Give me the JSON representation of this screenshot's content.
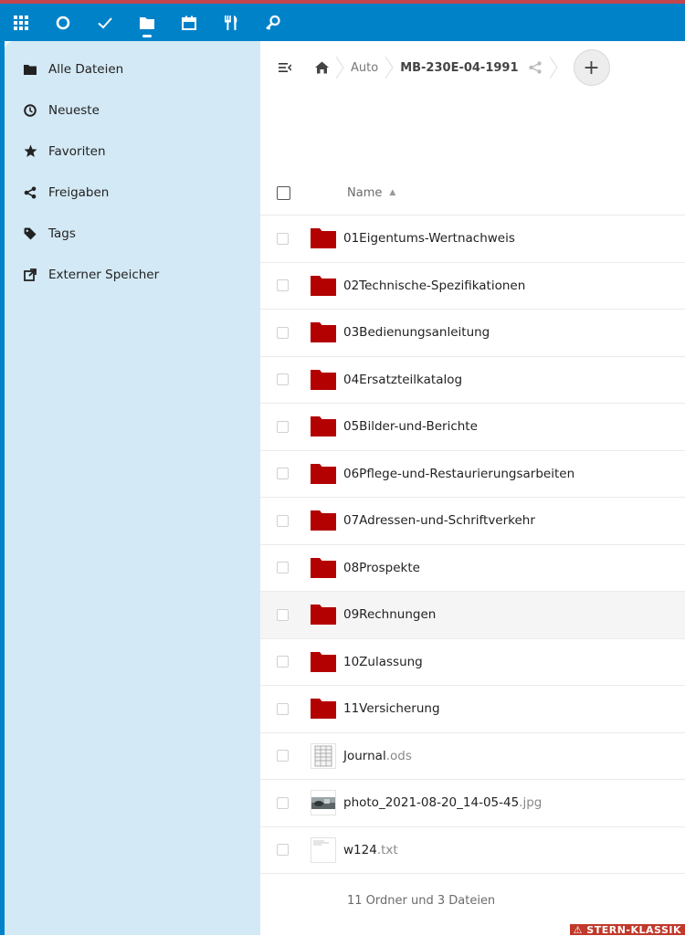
{
  "header": {
    "apps": [
      {
        "name": "app-menu-icon",
        "label": "Apps"
      },
      {
        "name": "dashboard-icon",
        "label": "Dashboard"
      },
      {
        "name": "tasks-icon",
        "label": "Tasks"
      },
      {
        "name": "files-icon",
        "label": "Files",
        "active": true
      },
      {
        "name": "calendar-icon",
        "label": "Calendar"
      },
      {
        "name": "cookbook-icon",
        "label": "Cookbook"
      },
      {
        "name": "passwords-icon",
        "label": "Passwords"
      }
    ],
    "color": "#0082c9"
  },
  "sidebar": {
    "items": [
      {
        "label": "Alle Dateien",
        "icon": "folder-icon"
      },
      {
        "label": "Neueste",
        "icon": "clock-icon"
      },
      {
        "label": "Favoriten",
        "icon": "star-icon"
      },
      {
        "label": "Freigaben",
        "icon": "share-icon"
      },
      {
        "label": "Tags",
        "icon": "tag-icon"
      },
      {
        "label": "Externer Speicher",
        "icon": "external-storage-icon"
      }
    ],
    "color": "#d3e9f5"
  },
  "breadcrumb": {
    "parent": "Auto",
    "current": "MB-230E-04-1991",
    "add_label": "+"
  },
  "table": {
    "header_name": "Name",
    "sort_arrow": "▲",
    "rows": [
      {
        "name": "01Eigentums-Wertnachweis",
        "ext": "",
        "type": "folder"
      },
      {
        "name": "02Technische-Spezifikationen",
        "ext": "",
        "type": "folder"
      },
      {
        "name": "03Bedienungsanleitung",
        "ext": "",
        "type": "folder"
      },
      {
        "name": "04Ersatzteilkatalog",
        "ext": "",
        "type": "folder"
      },
      {
        "name": "05Bilder-und-Berichte",
        "ext": "",
        "type": "folder"
      },
      {
        "name": "06Pflege-und-Restaurierungsarbeiten",
        "ext": "",
        "type": "folder"
      },
      {
        "name": "07Adressen-und-Schriftverkehr",
        "ext": "",
        "type": "folder"
      },
      {
        "name": "08Prospekte",
        "ext": "",
        "type": "folder"
      },
      {
        "name": "09Rechnungen",
        "ext": "",
        "type": "folder",
        "hover": true
      },
      {
        "name": "10Zulassung",
        "ext": "",
        "type": "folder"
      },
      {
        "name": "11Versicherung",
        "ext": "",
        "type": "folder"
      },
      {
        "name": "Journal",
        "ext": ".ods",
        "type": "spreadsheet"
      },
      {
        "name": "photo_2021-08-20_14-05-45",
        "ext": ".jpg",
        "type": "photo"
      },
      {
        "name": "w124",
        "ext": ".txt",
        "type": "text"
      }
    ],
    "summary": "11 Ordner und 3 Dateien",
    "folder_color": "#b30000"
  },
  "watermark": "⚠ STERN-KLASSIK"
}
